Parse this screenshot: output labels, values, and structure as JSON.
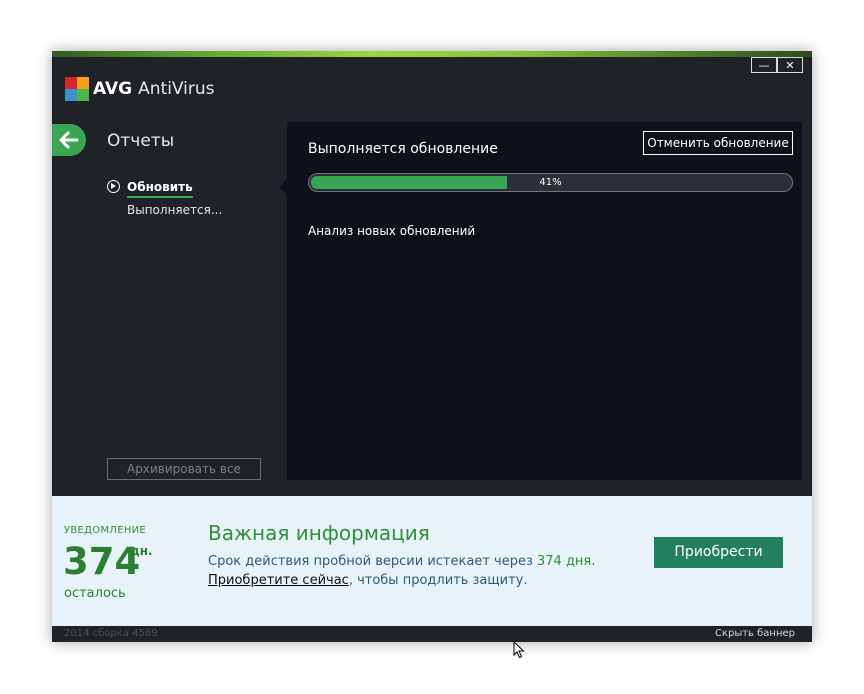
{
  "window": {
    "brand_avg": "AVG",
    "brand_product": "AntiVirus",
    "minimize_glyph": "—",
    "close_glyph": "✕"
  },
  "sidebar": {
    "title": "Отчеты",
    "item_label": "Обновить",
    "item_status": "Выполняется...",
    "archive_button": "Архивировать все"
  },
  "main": {
    "title": "Выполняется обновление",
    "cancel_button": "Отменить обновление",
    "progress_text": "41%",
    "progress_value": 0.41,
    "status_text": "Анализ новых обновлений"
  },
  "banner": {
    "notice_label": "УВЕДОМЛЕНИЕ",
    "days_number": "374",
    "days_unit": "дн.",
    "days_left": "осталось",
    "title": "Важная информация",
    "line1_prefix": "Срок действия пробной версии истекает через ",
    "line1_highlight": "374 дня",
    "line1_suffix": ".",
    "buy_link": "Приобретите сейчас",
    "line2_suffix": ", чтобы продлить защиту.",
    "buy_button": "Приобрести"
  },
  "statusbar": {
    "build_info": "2014  сборка 4569",
    "hide_banner": "Скрыть баннер"
  },
  "colors": {
    "accent_green": "#3aa553",
    "panel_dark": "#0d111c",
    "window_bg": "#1f2226",
    "banner_bg": "#e7f3f8",
    "buy_button_bg": "#23805f"
  },
  "icons": {
    "logo": "avg-logo-icon",
    "back": "arrow-left-icon",
    "play": "play-circle-icon",
    "cursor": "mouse-cursor-icon"
  }
}
